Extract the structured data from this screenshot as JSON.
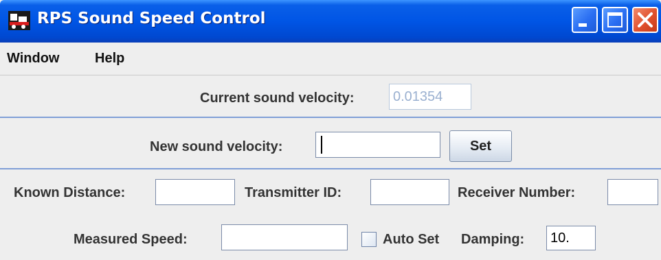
{
  "window": {
    "title": "RPS Sound Speed Control",
    "icon": "train-icon",
    "controls": [
      "minimize-icon",
      "maximize-icon",
      "close-icon"
    ]
  },
  "menu": [
    "Window",
    "Help"
  ],
  "current": {
    "label": "Current sound velocity:",
    "value": "0.01354"
  },
  "new_velocity": {
    "label": "New sound velocity:",
    "value": "",
    "button": "Set"
  },
  "calibration": {
    "known_distance_label": "Known Distance:",
    "known_distance_value": "",
    "transmitter_label": "Transmitter ID:",
    "transmitter_value": "",
    "receiver_label": "Receiver Number:",
    "receiver_value": "",
    "measured_label": "Measured Speed:",
    "measured_value": "",
    "auto_set_label": "Auto Set",
    "auto_set_checked": false,
    "damping_label": "Damping:",
    "damping_value": "10."
  },
  "colors": {
    "titlebar": "#0055e5",
    "close_button": "#e0502c",
    "separator": "#7f9ed6",
    "disabled_text": "#9ab0d0"
  }
}
